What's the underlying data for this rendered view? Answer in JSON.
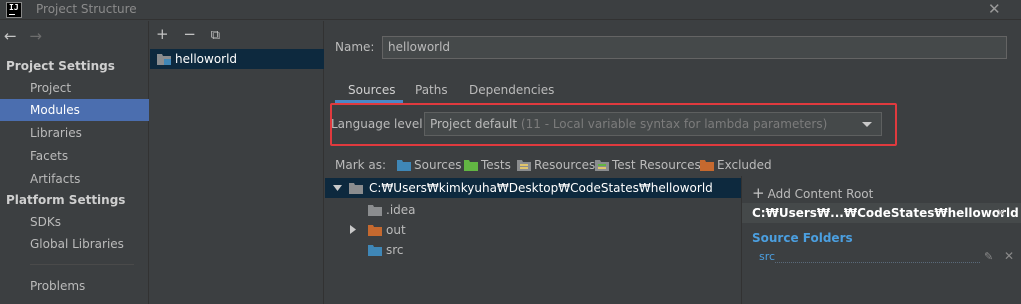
{
  "window": {
    "app_icon_text": "IJ",
    "title": "Project Structure",
    "close_glyph": "✕"
  },
  "sidebar": {
    "back_glyph": "←",
    "forward_glyph": "→",
    "project_settings_header": "Project Settings",
    "project_settings_items": [
      "Project",
      "Modules",
      "Libraries",
      "Facets",
      "Artifacts"
    ],
    "platform_settings_header": "Platform Settings",
    "platform_settings_items": [
      "SDKs",
      "Global Libraries"
    ],
    "problems_label": "Problems",
    "selected_item": "Modules"
  },
  "modules_panel": {
    "add_glyph": "+",
    "remove_glyph": "−",
    "copy_glyph": "⧉",
    "module_name": "helloworld"
  },
  "main": {
    "name_label": "Name:",
    "name_value": "helloworld",
    "tabs": [
      "Sources",
      "Paths",
      "Dependencies"
    ],
    "active_tab": "Sources",
    "language_level_label": "Language level:",
    "language_level_value": "Project default",
    "language_level_detail": "(11 - Local variable syntax for lambda parameters)",
    "mark_as_label": "Mark as:",
    "mark_as_buttons": [
      "Sources",
      "Tests",
      "Resources",
      "Test Resources",
      "Excluded"
    ]
  },
  "tree": {
    "root_path": "C:₩Users₩kimkyuha₩Desktop₩CodeStates₩helloworld",
    "children": [
      ".idea",
      "out",
      "src"
    ]
  },
  "right_pane": {
    "add_content_root_label": "Add Content Root",
    "content_root_path": "C:₩Users₩...₩CodeStates₩helloworld",
    "source_folders_header": "Source Folders",
    "source_folder_item": "src"
  },
  "colors": {
    "background": "#3c3f41",
    "selection_blue": "#4b6eaf",
    "tree_selection": "#0d293e",
    "highlight_box": "#e03a3e",
    "source_folder_blue": "#4b9fe0",
    "folder_sources": "#3f87b7",
    "folder_tests": "#62b543",
    "folder_excluded": "#c5692f",
    "folder_plain": "#8b8d8f"
  },
  "icons": {
    "sources": "blue-folder-icon",
    "tests": "green-folder-icon",
    "resources": "resources-folder-icon",
    "test_resources": "test-resources-folder-icon",
    "excluded": "orange-folder-icon",
    "module": "module-folder-icon",
    "edit": "pencil-icon",
    "remove": "close-icon"
  }
}
